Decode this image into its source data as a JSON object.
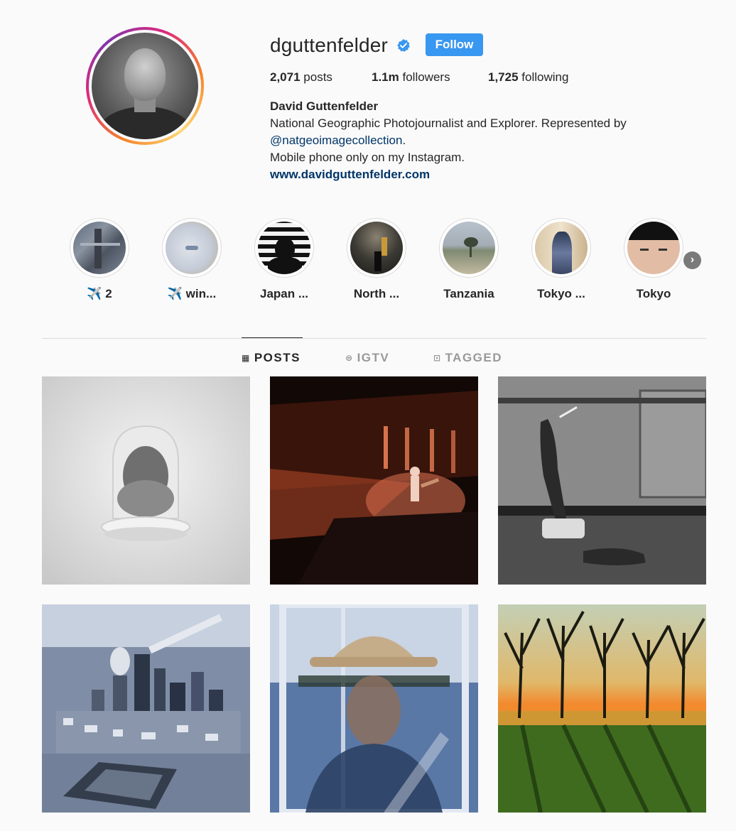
{
  "profile": {
    "username": "dguttenfelder",
    "verified_icon": "verified-badge-icon",
    "follow_label": "Follow",
    "stats": {
      "posts_count": "2,071",
      "posts_label": "posts",
      "followers_count": "1.1m",
      "followers_label": "followers",
      "following_count": "1,725",
      "following_label": "following"
    },
    "bio": {
      "full_name": "David Guttenfelder",
      "line1": "National Geographic Photojournalist and Explorer. Represented by",
      "mention": "@natgeoimagecollection",
      "line2_suffix": ".",
      "line3": "Mobile phone only on my Instagram.",
      "website": "www.davidguttenfelder.com"
    }
  },
  "highlights": [
    {
      "label": "✈️ 2"
    },
    {
      "label": "✈️ win..."
    },
    {
      "label": "Japan ..."
    },
    {
      "label": "North ..."
    },
    {
      "label": "Tanzania"
    },
    {
      "label": "Tokyo ..."
    },
    {
      "label": "Tokyo"
    }
  ],
  "tabs": [
    {
      "label": "POSTS",
      "icon": "grid-icon",
      "active": true
    },
    {
      "label": "IGTV",
      "icon": "igtv-icon",
      "active": false
    },
    {
      "label": "TAGGED",
      "icon": "tagged-icon",
      "active": false
    }
  ],
  "colors": {
    "follow_button": "#3897f0",
    "link": "#003569",
    "ring_gradient": [
      "#f58529",
      "#dd2a7b",
      "#8134af"
    ]
  },
  "posts": [
    {
      "subject": "dog-in-bowl"
    },
    {
      "subject": "concert-guitarist"
    },
    {
      "subject": "hands-under-door"
    },
    {
      "subject": "snowy-city-aerial"
    },
    {
      "subject": "double-exposure-portrait"
    },
    {
      "subject": "trees-at-sunset"
    }
  ]
}
